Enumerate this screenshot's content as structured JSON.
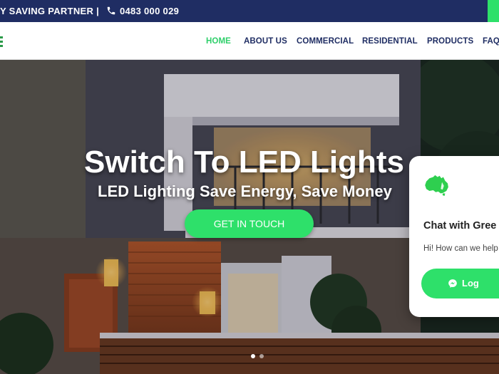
{
  "topbar": {
    "partner_text": "Y SAVING PARTNER |",
    "phone": "0483 000 029",
    "phone_icon": "phone-icon",
    "background": "#1f2d63",
    "accent": "#2ee06a"
  },
  "nav": {
    "items": [
      {
        "label": "HOME",
        "active": true
      },
      {
        "label": "ABOUT US",
        "active": false
      },
      {
        "label": "COMMERCIAL",
        "active": false
      },
      {
        "label": "RESIDENTIAL",
        "active": false
      },
      {
        "label": "PRODUCTS",
        "active": false
      },
      {
        "label": "FAQS",
        "active": false
      }
    ],
    "active_color": "#2ecf6a",
    "text_color": "#1f2d63"
  },
  "hero": {
    "title": "Switch To LED Lights",
    "subtitle": "LED Lighting Save Energy, Save Money",
    "cta_label": "GET IN TOUCH",
    "slides": 2,
    "active_slide": 1
  },
  "chat": {
    "icon": "australia-map-icon",
    "title": "Chat with Gree",
    "message": "Hi! How can we help",
    "login_label": "Log",
    "login_icon": "messenger-icon"
  }
}
